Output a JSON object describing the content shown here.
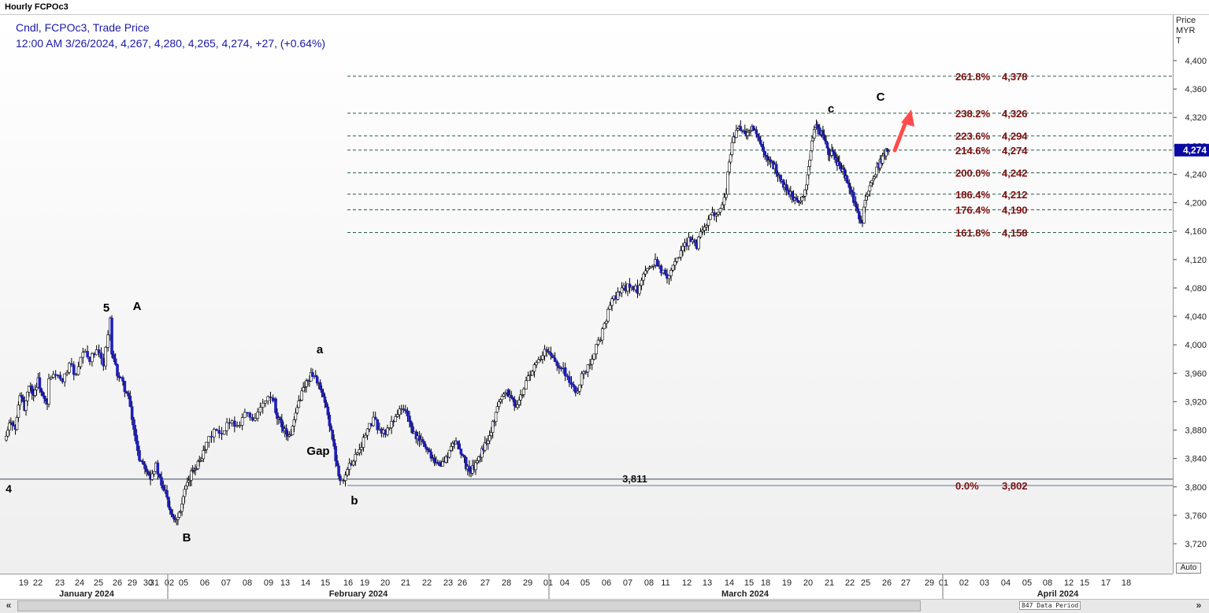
{
  "window": {
    "title": "Hourly FCPOc3"
  },
  "legend": {
    "line1": "Cndl, FCPOc3, Trade Price",
    "line2": "12:00 AM 3/26/2024, 4,267, 4,280, 4,265, 4,274, +27, (+0.64%)"
  },
  "yaxis_header": [
    "Price",
    "MYR",
    "T"
  ],
  "auto_button": "Auto",
  "scrollbar": {
    "left_arrow": "«",
    "right_arrow": "»",
    "data_period": "847 Data Period"
  },
  "colors": {
    "bull": "#ffffff",
    "bear": "#1f1fb8",
    "wick": "#000000",
    "fib_text": "#7a0f0f",
    "fib_line": "#2a5d4a",
    "arrow": "#ff4b4b",
    "legend_text": "#1a1aa6",
    "last_price_bg": "#0a0aa0"
  },
  "chart_data": {
    "type": "candlestick",
    "title": "Hourly FCPOc3",
    "ylabel": "Price MYR T",
    "ylim": [
      3690,
      4440
    ],
    "y_ticks": [
      "3,720",
      "3,760",
      "3,800",
      "3,840",
      "3,880",
      "3,920",
      "3,960",
      "4,000",
      "4,040",
      "4,080",
      "4,120",
      "4,160",
      "4,200",
      "4,240",
      "4,280",
      "4,320",
      "4,360",
      "4,400"
    ],
    "x_date_labels": [
      "19",
      "22",
      "23",
      "24",
      "25",
      "26",
      "29",
      "30",
      "31",
      "02",
      "05",
      "06",
      "07",
      "08",
      "09",
      "13",
      "14",
      "15",
      "16",
      "19",
      "20",
      "21",
      "22",
      "23",
      "26",
      "27",
      "28",
      "29",
      "01",
      "04",
      "05",
      "06",
      "07",
      "08",
      "11",
      "12",
      "13",
      "14",
      "15",
      "18",
      "19",
      "20",
      "21",
      "22",
      "25",
      "26",
      "27",
      "29",
      "01",
      "02",
      "03",
      "04",
      "05",
      "08",
      "12",
      "15",
      "17",
      "18"
    ],
    "x_month_labels": [
      "January 2024",
      "February 2024",
      "March 2024",
      "April 2024"
    ],
    "last_price": "4,274",
    "fib_levels": [
      {
        "label": "261.8%",
        "value": "4,378"
      },
      {
        "label": "238.2%",
        "value": "4,326"
      },
      {
        "label": "223.6%",
        "value": "4,294"
      },
      {
        "label": "214.6%",
        "value": "4,274"
      },
      {
        "label": "200.0%",
        "value": "4,242"
      },
      {
        "label": "186.4%",
        "value": "4,212"
      },
      {
        "label": "176.4%",
        "value": "4,190"
      },
      {
        "label": "161.8%",
        "value": "4,158"
      },
      {
        "label": "0.0%",
        "value": "3,802"
      }
    ],
    "horizontal_line": {
      "label": "3,811",
      "value": 3811
    },
    "wave_labels": [
      "5",
      "A",
      "B",
      "a",
      "b",
      "Gap",
      "c",
      "C",
      "4"
    ],
    "price_path": [
      [
        3870,
        3895,
        3880,
        3930,
        3910,
        3945,
        3930,
        3950,
        3925,
        3915
      ],
      [
        3950,
        3960,
        3945,
        3975,
        3955,
        3990,
        3980,
        3990,
        3975,
        4035
      ],
      [
        3985,
        3960,
        3945,
        3925,
        3880,
        3840,
        3830,
        3815,
        3830,
        3800,
        3790
      ],
      [
        3775,
        3760,
        3755,
        3770,
        3795,
        3805,
        3825,
        3830,
        3840,
        3850
      ],
      [
        3860,
        3880,
        3870,
        3895,
        3885,
        3905,
        3895,
        3910,
        3925,
        3920
      ],
      [
        3900,
        3890,
        3880,
        3870,
        3890,
        3920,
        3940,
        3950,
        3960,
        3950,
        3930,
        3910,
        3880,
        3840,
        3810
      ],
      [
        3810,
        3830,
        3845,
        3860,
        3880,
        3895,
        3880,
        3875,
        3890,
        3905,
        3910,
        3895
      ],
      [
        3880,
        3870,
        3865,
        3855,
        3845,
        3835,
        3830,
        3840,
        3855,
        3865,
        3850,
        3830,
        3820
      ],
      [
        3825,
        3835,
        3850,
        3865,
        3880,
        3905,
        3925,
        3935,
        3930,
        3915,
        3920,
        3935
      ],
      [
        3950,
        3965,
        3975,
        3990,
        3985,
        3975,
        3965,
        3950,
        3930,
        3955,
        3970,
        3990,
        4010,
        4035
      ],
      [
        4050,
        4065,
        4075,
        4080,
        4085,
        4075,
        4095,
        4110,
        4120,
        4105,
        4095,
        4115,
        4125,
        4140,
        4150,
        4140,
        4165,
        4175,
        4185,
        4195,
        4210
      ],
      [
        4245,
        4285,
        4300,
        4305,
        4295,
        4300,
        4305,
        4290,
        4275,
        4260,
        4255,
        4250,
        4235,
        4225,
        4215,
        4210,
        4205,
        4200,
        4215
      ],
      [
        4230,
        4260,
        4295,
        4310,
        4300,
        4295,
        4280,
        4265,
        4275,
        4260,
        4250,
        4245,
        4235,
        4220,
        4210,
        4190,
        4180,
        4175
      ],
      [
        4195,
        4210,
        4225,
        4240,
        4250,
        4260,
        4270,
        4274
      ]
    ]
  }
}
